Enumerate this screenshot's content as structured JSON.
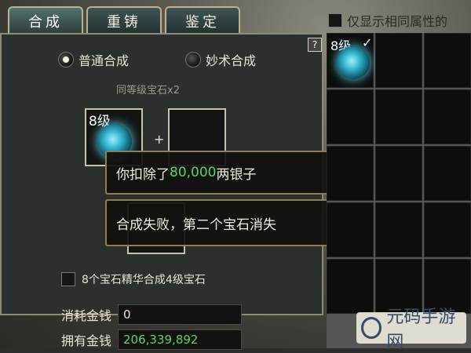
{
  "tabs": [
    {
      "label": "合成"
    },
    {
      "label": "重铸"
    },
    {
      "label": "鉴定"
    }
  ],
  "filter": {
    "label": "仅显示相同属性的"
  },
  "help": {
    "label": "?"
  },
  "modes": {
    "normal": "普通合成",
    "magic": "妙术合成"
  },
  "requirement": "同等级宝石x2",
  "slots": {
    "left_level": "8级",
    "plus": "+"
  },
  "toasts": {
    "deduct_prefix": "你扣除了",
    "deduct_amount": "80,000",
    "deduct_suffix": "两银子",
    "fail": "合成失败，第二个宝石消失"
  },
  "essence": {
    "label": "8个宝石精华合成4级宝石"
  },
  "cost": {
    "label": "消耗金钱",
    "value": "0"
  },
  "owned": {
    "label": "拥有金钱",
    "value": "206,339,892"
  },
  "inventory": {
    "first_level": "8级",
    "first_check": "✓"
  },
  "watermark": {
    "text": "元码手游网"
  }
}
